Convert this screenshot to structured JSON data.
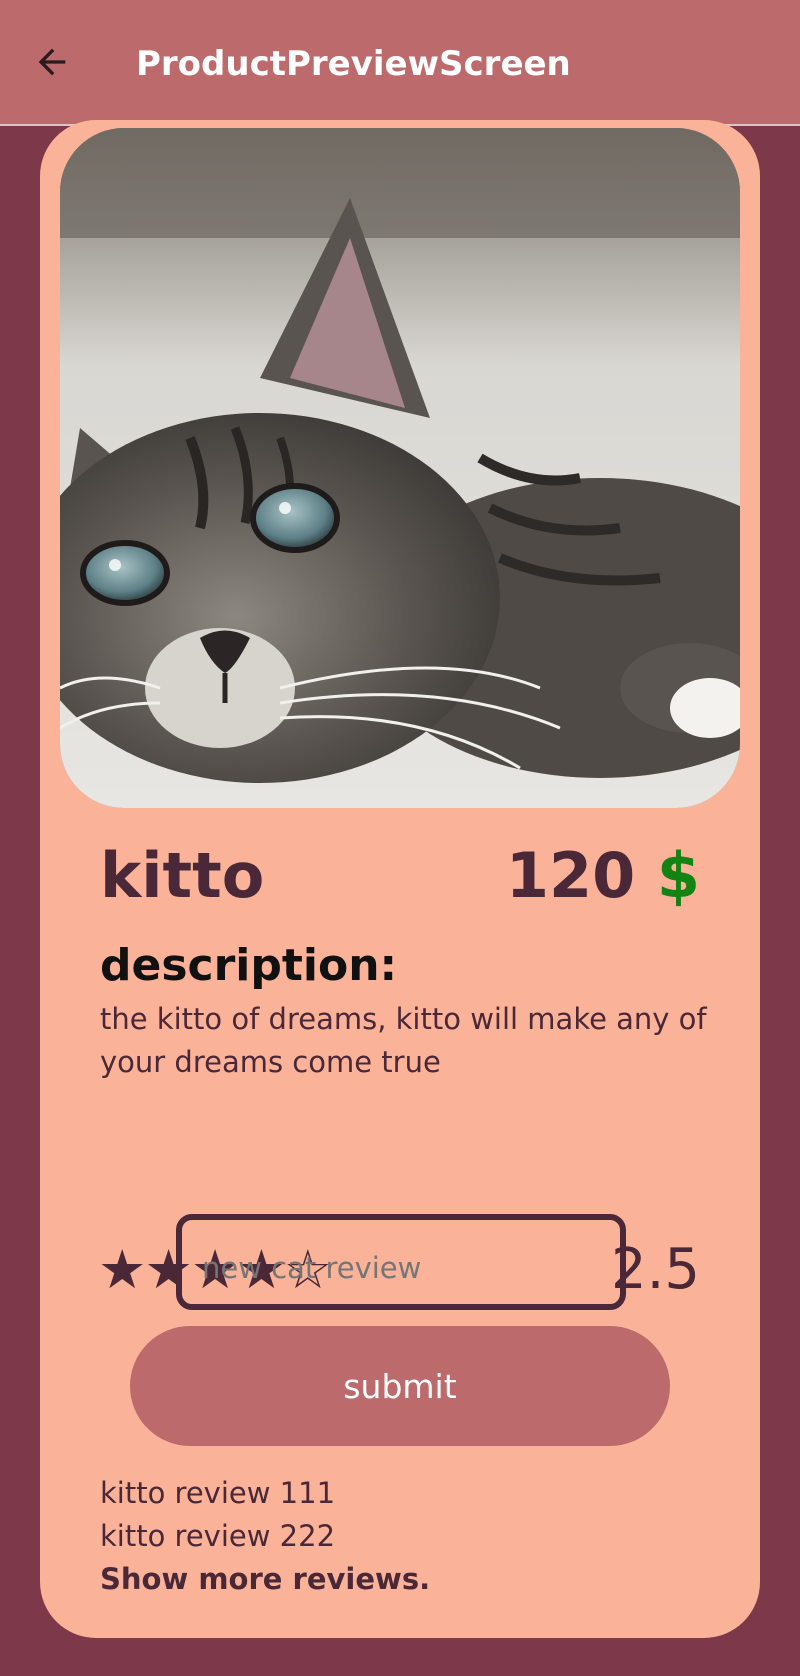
{
  "appbar": {
    "title": "ProductPreviewScreen",
    "back_icon": "arrow-left-icon"
  },
  "product": {
    "name": "kitto",
    "price_value": "120",
    "price_currency": "$",
    "description_label": "description:",
    "description": "the kitto of dreams, kitto will make any of your dreams come true",
    "stars_display": "★★★★☆",
    "stars_filled": 4,
    "stars_total": 5,
    "rating": "2.5",
    "image_icon": "cat-photo"
  },
  "review_form": {
    "placeholder": "new cat review",
    "submit_label": "submit"
  },
  "reviews": {
    "items": [
      "kitto review 111",
      "kitto review 222"
    ],
    "show_more_label": "Show more reviews."
  },
  "colors": {
    "background": "#7d394a",
    "appbar": "#bd6a6c",
    "card": "#fab398",
    "text": "#4a2838",
    "currency": "#138313",
    "button": "#bd6a6c"
  }
}
